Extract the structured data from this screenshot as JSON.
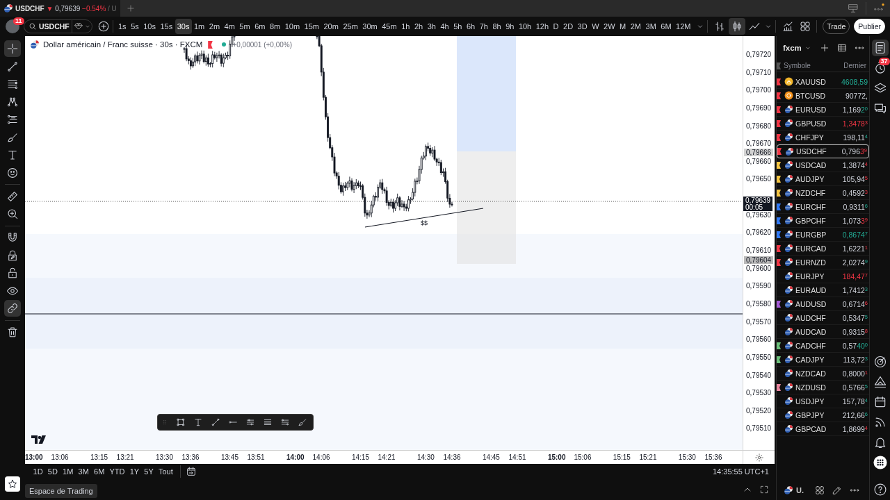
{
  "title_bar": {
    "tab": {
      "symbol": "USDCHF",
      "arrow": "▼",
      "price": "0,79639",
      "change": "−0.54%",
      "suffix": "/ U",
      "falling": true
    }
  },
  "toolbar": {
    "avatar_badge": "11",
    "symbol": "USDCHF",
    "intervals": [
      {
        "label": "1s",
        "selected": false
      },
      {
        "label": "5s",
        "selected": false
      },
      {
        "label": "10s",
        "selected": false
      },
      {
        "label": "15s",
        "selected": false
      },
      {
        "label": "30s",
        "selected": true
      },
      {
        "label": "1m",
        "selected": false
      },
      {
        "label": "2m",
        "selected": false
      },
      {
        "label": "4m",
        "selected": false
      },
      {
        "label": "5m",
        "selected": false
      },
      {
        "label": "6m",
        "selected": false
      },
      {
        "label": "8m",
        "selected": false
      },
      {
        "label": "10m",
        "selected": false
      },
      {
        "label": "15m",
        "selected": false
      },
      {
        "label": "20m",
        "selected": false
      },
      {
        "label": "25m",
        "selected": false
      },
      {
        "label": "30m",
        "selected": false
      },
      {
        "label": "45m",
        "selected": false
      },
      {
        "label": "1h",
        "selected": false
      },
      {
        "label": "2h",
        "selected": false
      },
      {
        "label": "3h",
        "selected": false
      },
      {
        "label": "4h",
        "selected": false
      },
      {
        "label": "5h",
        "selected": false
      },
      {
        "label": "6h",
        "selected": false
      },
      {
        "label": "7h",
        "selected": false
      },
      {
        "label": "8h",
        "selected": false
      },
      {
        "label": "9h",
        "selected": false
      },
      {
        "label": "10h",
        "selected": false
      },
      {
        "label": "12h",
        "selected": false
      },
      {
        "label": "D",
        "selected": false
      },
      {
        "label": "2D",
        "selected": false
      },
      {
        "label": "3D",
        "selected": false
      },
      {
        "label": "W",
        "selected": false
      },
      {
        "label": "2W",
        "selected": false
      },
      {
        "label": "M",
        "selected": false
      },
      {
        "label": "2M",
        "selected": false
      },
      {
        "label": "3M",
        "selected": false
      },
      {
        "label": "6M",
        "selected": false
      },
      {
        "label": "12M",
        "selected": false
      }
    ],
    "chart_styles": [
      {
        "kind": "bars",
        "selected": false
      },
      {
        "kind": "candles",
        "selected": true
      },
      {
        "kind": "line",
        "selected": false
      }
    ],
    "buttons": [
      {
        "label": "Trade",
        "kind": "outline"
      },
      {
        "label": "Publier",
        "kind": "filled"
      }
    ]
  },
  "left_toolbar": {
    "groups": [
      {
        "tools": [
          {
            "kind": "crosshair",
            "selected": true
          },
          {
            "kind": "trendline",
            "selected": false
          },
          {
            "kind": "hlines",
            "selected": false
          },
          {
            "kind": "pattern",
            "selected": false
          },
          {
            "kind": "fib",
            "selected": false
          },
          {
            "kind": "brush",
            "selected": false
          },
          {
            "kind": "text",
            "selected": false
          },
          {
            "kind": "emoji",
            "selected": false
          }
        ]
      },
      {
        "tools": [
          {
            "kind": "ruler",
            "selected": false
          },
          {
            "kind": "zoom",
            "selected": false
          }
        ]
      },
      {
        "tools": [
          {
            "kind": "magnet",
            "selected": false
          },
          {
            "kind": "lockdraw",
            "selected": false
          },
          {
            "kind": "lock",
            "selected": false
          },
          {
            "kind": "eye",
            "selected": false
          },
          {
            "kind": "link",
            "selected": true
          }
        ]
      },
      {
        "tools": [
          {
            "kind": "trash",
            "selected": false
          }
        ]
      }
    ]
  },
  "chart": {
    "legend": {
      "title": "Dollar américain / Franc suisse · 30s · FXCM",
      "change": "+0,00001 (+0,00%)"
    },
    "annotation": "$$",
    "price_axis": {
      "upper": [
        "0,79720",
        "0,79710",
        "0,79700",
        "0,79690",
        "0,79680",
        "0,79670",
        "0,79660",
        "0,79650"
      ],
      "current": {
        "price": "0,79639",
        "countdown": "00:05"
      },
      "lower": [
        "0,79630",
        "0,79620",
        "0,79610",
        "0,79600",
        "0,79590",
        "0,79580",
        "0,79570",
        "0,79560",
        "0,79550",
        "0,79540",
        "0,79530",
        "0,79520",
        "0,79510"
      ],
      "marks": [
        "0,79666",
        "0,79604"
      ]
    },
    "time_axis": [
      {
        "label": "13:00",
        "major": true
      },
      {
        "label": "13:06",
        "major": false
      },
      {
        "label": "13:15",
        "major": false
      },
      {
        "label": "13:21",
        "major": false
      },
      {
        "label": "13:30",
        "major": false
      },
      {
        "label": "13:36",
        "major": false
      },
      {
        "label": "13:45",
        "major": false
      },
      {
        "label": "13:51",
        "major": false
      },
      {
        "label": "14:00",
        "major": true
      },
      {
        "label": "14:06",
        "major": false
      },
      {
        "label": "14:15",
        "major": false
      },
      {
        "label": "14:21",
        "major": false
      },
      {
        "label": "14:30",
        "major": false
      },
      {
        "label": "14:36",
        "major": false
      },
      {
        "label": "14:45",
        "major": false
      },
      {
        "label": "14:51",
        "major": false
      },
      {
        "label": "15:00",
        "major": true
      },
      {
        "label": "15:06",
        "major": false
      },
      {
        "label": "15:15",
        "major": false
      },
      {
        "label": "15:21",
        "major": false
      },
      {
        "label": "15:30",
        "major": false
      },
      {
        "label": "15:36",
        "major": false
      }
    ]
  },
  "range_bar": {
    "ranges": [
      "1D",
      "5D",
      "1M",
      "3M",
      "6M",
      "YTD",
      "1Y",
      "5Y",
      "Tout"
    ],
    "clock": "14:35:55 UTC+1"
  },
  "footer": {
    "tab": "Espace de Trading"
  },
  "watchlist": {
    "name": "fxcm",
    "columns": [
      "Symbole",
      "Dernier"
    ],
    "rows": [
      {
        "symbol": "XAUUSD",
        "kind": "metal",
        "color": "#f23645",
        "changed": "4608,59",
        "rising": true,
        "selected": false
      },
      {
        "symbol": "BTCUSD",
        "kind": "crypto",
        "color": "#f23645",
        "price": "90772,",
        "selected": false
      },
      {
        "symbol": "EURUSD",
        "kind": "pair",
        "color": "#f23645",
        "price": "1,169",
        "changed": "2",
        "pip": "0",
        "rising": true,
        "selected": false
      },
      {
        "symbol": "GBPUSD",
        "kind": "pair",
        "color": "#f23645",
        "changed": "1,3478",
        "pip": "3",
        "rising": false,
        "selected": false
      },
      {
        "symbol": "CHFJPY",
        "kind": "pair",
        "color": "#f23645",
        "price": "198,11",
        "pip": "4",
        "rising": true,
        "selected": false
      },
      {
        "symbol": "USDCHF",
        "kind": "pair",
        "color": "#f23645",
        "price": "0,796",
        "changed": "3",
        "pip": "9",
        "rising": false,
        "selected": true
      },
      {
        "symbol": "USDCAD",
        "kind": "pair",
        "color": "#f5c542",
        "price": "1,3874",
        "pip": "4",
        "rising": false,
        "selected": false
      },
      {
        "symbol": "AUDJPY",
        "kind": "pair",
        "color": "#f5c542",
        "price": "105,94",
        "pip": "5",
        "rising": false,
        "selected": false
      },
      {
        "symbol": "NZDCHF",
        "kind": "pair",
        "color": "#f5c542",
        "price": "0,4592",
        "pip": "3",
        "rising": false,
        "selected": false
      },
      {
        "symbol": "EURCHF",
        "kind": "pair",
        "color": "#3179f5",
        "price": "0,9311",
        "pip": "6",
        "rising": true,
        "selected": false
      },
      {
        "symbol": "GBPCHF",
        "kind": "pair",
        "color": "#3179f5",
        "price": "1,073",
        "changed": "3",
        "pip": "9",
        "rising": false,
        "selected": false
      },
      {
        "symbol": "EURGBP",
        "kind": "pair",
        "color": "#3179f5",
        "changed": "0,8674",
        "pip": "7",
        "rising": true,
        "selected": false
      },
      {
        "symbol": "EURCAD",
        "kind": "pair",
        "color": "#f23645",
        "price": "1,6221",
        "pip": "1",
        "rising": false,
        "selected": false
      },
      {
        "symbol": "EURNZD",
        "kind": "pair",
        "color": "#f23645",
        "price": "2,0274",
        "pip": "9",
        "rising": true,
        "selected": false
      },
      {
        "symbol": "EURJPY",
        "kind": "pair",
        "changed": "184,47",
        "pip": "7",
        "rising": false,
        "selected": false
      },
      {
        "symbol": "EURAUD",
        "kind": "pair",
        "price": "1,7412",
        "pip": "3",
        "rising": true,
        "selected": false
      },
      {
        "symbol": "AUDUSD",
        "kind": "pair",
        "color": "#a55ad6",
        "price": "0,6714",
        "pip": "6",
        "rising": false,
        "selected": false
      },
      {
        "symbol": "AUDCHF",
        "kind": "pair",
        "price": "0,5347",
        "pip": "5",
        "rising": true,
        "selected": false
      },
      {
        "symbol": "AUDCAD",
        "kind": "pair",
        "price": "0,9315",
        "pip": "8",
        "rising": false,
        "selected": false
      },
      {
        "symbol": "CADCHF",
        "kind": "pair",
        "color": "#6cc07a",
        "price": "0,57",
        "changed": "40",
        "pip": "0",
        "rising": true,
        "selected": false
      },
      {
        "symbol": "CADJPY",
        "kind": "pair",
        "color": "#6cc07a",
        "price": "113,72",
        "pip": "3",
        "rising": true,
        "selected": false
      },
      {
        "symbol": "NZDCAD",
        "kind": "pair",
        "price": "0,8000",
        "pip": "1",
        "rising": false,
        "selected": false
      },
      {
        "symbol": "NZDUSD",
        "kind": "pair",
        "color": "#e9859e",
        "price": "0,5766",
        "pip": "5",
        "rising": true,
        "selected": false
      },
      {
        "symbol": "USDJPY",
        "kind": "pair",
        "price": "157,78",
        "pip": "4",
        "rising": true,
        "selected": false
      },
      {
        "symbol": "GBPJPY",
        "kind": "pair",
        "price": "212,66",
        "pip": "6",
        "rising": true,
        "selected": false
      },
      {
        "symbol": "GBPCAD",
        "kind": "pair",
        "price": "1,8699",
        "pip": "4",
        "rising": false,
        "selected": false
      }
    ],
    "footer_symbol": "U."
  },
  "right_bar": {
    "top": [
      {
        "kind": "watchlist",
        "selected": true
      },
      {
        "kind": "alerts",
        "badge": "37",
        "selected": false
      },
      {
        "kind": "layers",
        "selected": false
      },
      {
        "kind": "chat",
        "selected": false
      }
    ],
    "bottom": [
      {
        "kind": "target"
      },
      {
        "kind": "ideas"
      },
      {
        "kind": "calendar"
      },
      {
        "kind": "broadcast"
      },
      {
        "kind": "bell"
      },
      {
        "kind": "apps"
      },
      {
        "kind": "help"
      }
    ]
  }
}
